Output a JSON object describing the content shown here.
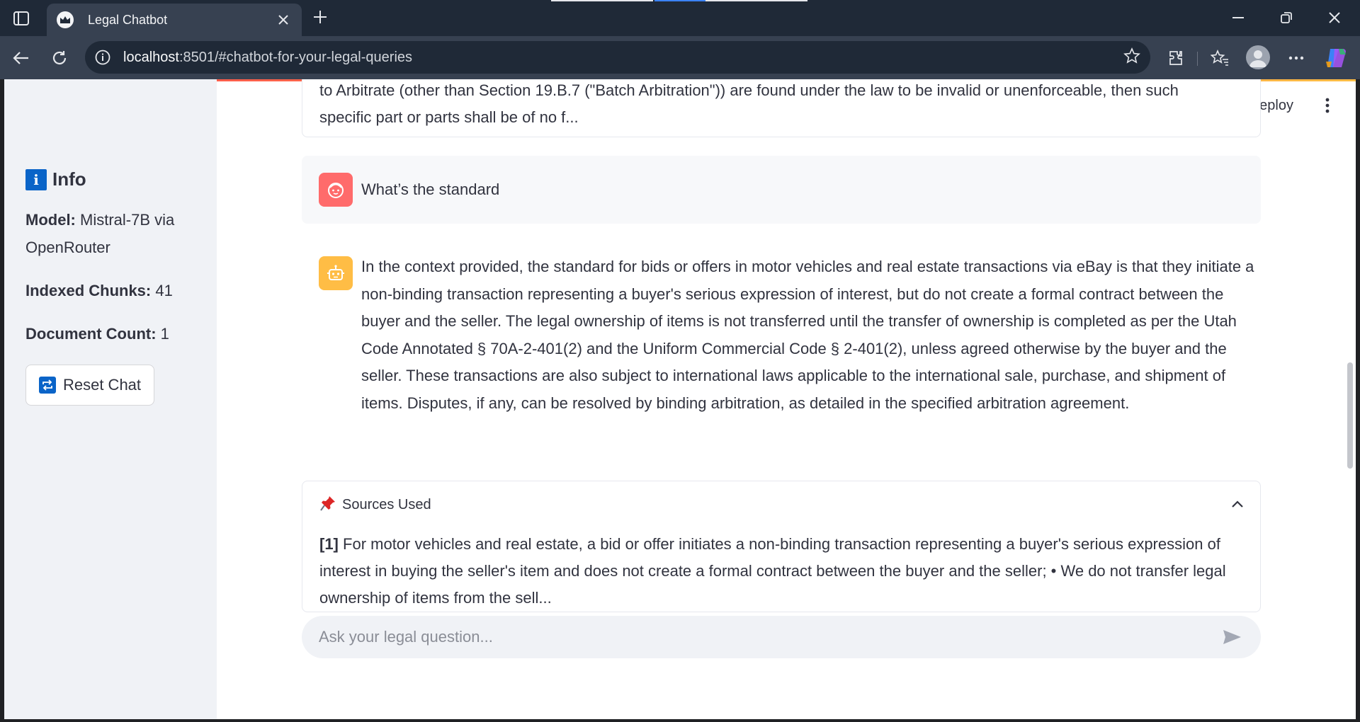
{
  "browser": {
    "tab_title": "Legal Chatbot",
    "url_host": "localhost",
    "url_rest": ":8501/#chatbot-for-your-legal-queries"
  },
  "sidebar": {
    "info_title": "Info",
    "info_icon_letter": "i",
    "model_label": "Model:",
    "model_value": "Mistral-7B via OpenRouter",
    "chunks_label": "Indexed Chunks:",
    "chunks_value": "41",
    "doc_label": "Document Count:",
    "doc_value": "1",
    "reset_label": "Reset Chat"
  },
  "header": {
    "deploy_label": "Deploy"
  },
  "chat": {
    "prev_card_text_line1": "to Arbitrate (other than Section 19.B.7 (\"Batch Arbitration\")) are found under the law to be invalid or unenforceable, then such",
    "prev_card_text_line2": "specific part or parts shall be of no f...",
    "user_message": "What’s the standard",
    "bot_message": "In the context provided, the standard for bids or offers in motor vehicles and real estate transactions via eBay is that they initiate a non-binding transaction representing a buyer's serious expression of interest, but do not create a formal contract between the buyer and the seller. The legal ownership of items is not transferred until the transfer of ownership is completed as per the Utah Code Annotated § 70A-2-401(2) and the Uniform Commercial Code § 2-401(2), unless agreed otherwise by the buyer and the seller. These transactions are also subject to international laws applicable to the international sale, purchase, and shipment of items. Disputes, if any, can be resolved by binding arbitration, as detailed in the specified arbitration agreement.",
    "sources_title": "Sources Used",
    "source_ref": "[1]",
    "source_text": "For motor vehicles and real estate, a bid or offer initiates a non-binding transaction representing a buyer's serious expression of interest in buying the seller's item and does not create a formal contract between the buyer and the seller; • We do not transfer legal ownership of items from the sell...",
    "input_placeholder": "Ask your legal question..."
  },
  "colors": {
    "sidebar_bg": "#f0f2f6",
    "user_avatar": "#ff6b6b",
    "bot_avatar": "#ffbd45",
    "info_icon": "#0a64c8",
    "text": "#31333f"
  }
}
